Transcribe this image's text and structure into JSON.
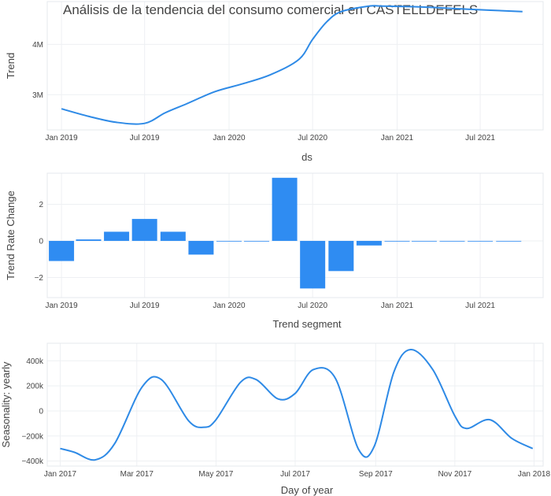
{
  "title": "Análisis de la tendencia del consumo comercial en CASTELLDEFELS",
  "colors": {
    "line": "#2e8ae6",
    "bar": "#2f8cf2",
    "grid": "#eef0f3"
  },
  "chart_data": [
    {
      "type": "line",
      "xlabel": "ds",
      "ylabel": "Trend",
      "x_ticks": [
        "Jan 2019",
        "Jul 2019",
        "Jan 2020",
        "Jul 2020",
        "Jan 2021",
        "Jul 2021"
      ],
      "y_ticks": [
        "3M",
        "4M"
      ],
      "ylim": [
        2300000,
        4850000
      ],
      "x": [
        "2019-01-01",
        "2019-03-01",
        "2019-05-01",
        "2019-07-01",
        "2019-08-15",
        "2019-10-01",
        "2019-12-01",
        "2020-02-01",
        "2020-04-01",
        "2020-06-01",
        "2020-07-01",
        "2020-08-01",
        "2020-09-01",
        "2020-11-01",
        "2020-12-01",
        "2021-03-01",
        "2021-06-01",
        "2021-10-01"
      ],
      "y": [
        2720000,
        2570000,
        2450000,
        2430000,
        2640000,
        2820000,
        3060000,
        3220000,
        3400000,
        3700000,
        4100000,
        4450000,
        4650000,
        4760000,
        4760000,
        4740000,
        4700000,
        4650000
      ]
    },
    {
      "type": "bar",
      "xlabel": "Trend segment",
      "ylabel": "Trend Rate Change",
      "x_ticks": [
        "Jan 2019",
        "Jul 2019",
        "Jan 2020",
        "Jul 2020",
        "Jan 2021",
        "Jul 2021"
      ],
      "y_ticks": [
        "−2",
        "0",
        "2"
      ],
      "ylim": [
        -3.1,
        3.7
      ],
      "x": [
        "2019-01-01",
        "2019-03-01",
        "2019-05-01",
        "2019-07-01",
        "2019-09-01",
        "2019-11-01",
        "2020-01-01",
        "2020-03-01",
        "2020-05-01",
        "2020-07-01",
        "2020-09-01",
        "2020-11-01",
        "2021-01-01",
        "2021-03-01",
        "2021-05-01",
        "2021-07-01",
        "2021-09-01"
      ],
      "values": [
        -1.1,
        0.08,
        0.5,
        1.2,
        0.5,
        -0.75,
        0,
        0,
        3.45,
        -2.6,
        -1.65,
        -0.25,
        0,
        0,
        0,
        0,
        0
      ]
    },
    {
      "type": "line",
      "xlabel": "Day of year",
      "ylabel": "Seasonality: yearly",
      "x_ticks": [
        "Jan 2017",
        "Mar 2017",
        "May 2017",
        "Jul 2017",
        "Sep 2017",
        "Nov 2017",
        "Jan 2018"
      ],
      "y_ticks": [
        "−400k",
        "−200k",
        "0",
        "200k",
        "400k"
      ],
      "ylim": [
        -440000,
        540000
      ],
      "x": [
        "2017-01-01",
        "2017-01-12",
        "2017-01-28",
        "2017-02-12",
        "2017-03-05",
        "2017-03-20",
        "2017-04-10",
        "2017-04-22",
        "2017-05-01",
        "2017-05-20",
        "2017-06-01",
        "2017-06-18",
        "2017-07-01",
        "2017-07-15",
        "2017-08-01",
        "2017-08-19",
        "2017-08-31",
        "2017-09-15",
        "2017-09-28",
        "2017-10-15",
        "2017-11-01",
        "2017-11-10",
        "2017-11-28",
        "2017-12-15",
        "2017-12-31"
      ],
      "y": [
        -300000,
        -330000,
        -390000,
        -260000,
        190000,
        250000,
        -80000,
        -130000,
        -70000,
        230000,
        250000,
        95000,
        140000,
        330000,
        260000,
        -310000,
        -280000,
        310000,
        490000,
        330000,
        -40000,
        -140000,
        -70000,
        -220000,
        -300000
      ]
    }
  ]
}
